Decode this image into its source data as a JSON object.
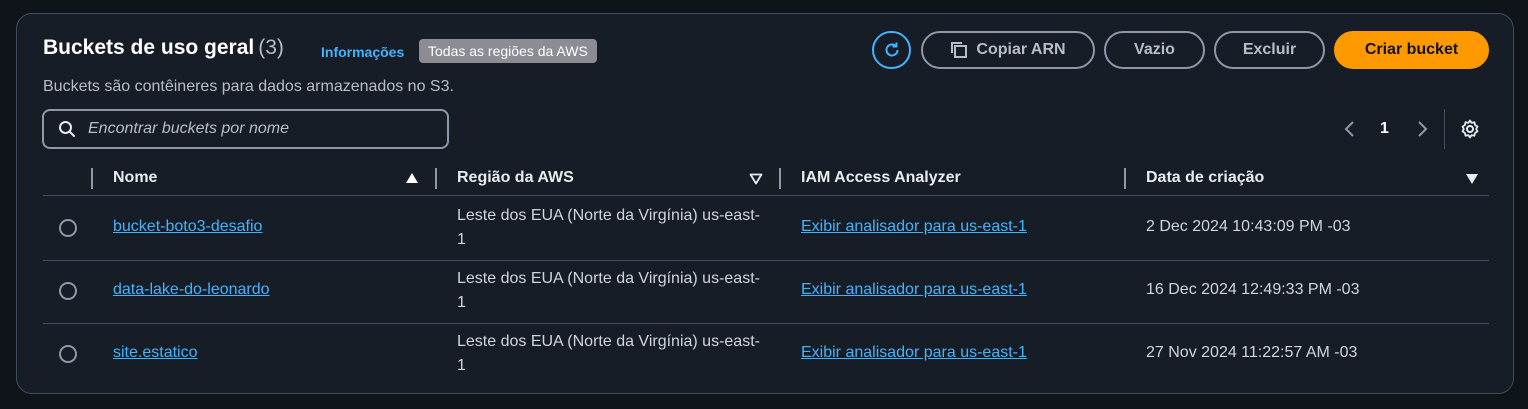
{
  "header": {
    "title": "Buckets de uso geral",
    "count": "(3)",
    "info_link": "Informações",
    "region_badge": "Todas as regiões da AWS",
    "subtitle": "Buckets são contêineres para dados armazenados no S3."
  },
  "toolbar": {
    "refresh_icon": "refresh-icon",
    "copy_arn_label": "Copiar ARN",
    "empty_label": "Vazio",
    "delete_label": "Excluir",
    "create_label": "Criar bucket"
  },
  "search": {
    "placeholder": "Encontrar buckets por nome",
    "value": ""
  },
  "pagination": {
    "current_page": "1"
  },
  "table": {
    "headers": [
      "Nome",
      "Região da AWS",
      "IAM Access Analyzer",
      "Data de criação"
    ],
    "rows": [
      {
        "name": "bucket-boto3-desafio",
        "region": "Leste dos EUA (Norte da Virgínia) us-east-1",
        "iam": "Exibir analisador para us-east-1",
        "created": "2 Dec 2024 10:43:09 PM -03"
      },
      {
        "name": "data-lake-do-leonardo",
        "region": "Leste dos EUA (Norte da Virgínia) us-east-1",
        "iam": "Exibir analisador para us-east-1",
        "created": "16 Dec 2024 12:49:33 PM -03"
      },
      {
        "name": "site.estatico",
        "region": "Leste dos EUA (Norte da Virgínia) us-east-1",
        "iam": "Exibir analisador para us-east-1",
        "created": "27 Nov 2024 11:22:57 AM -03"
      }
    ]
  },
  "colors": {
    "accent": "#ff9900",
    "link": "#42b4ff",
    "background": "#161d26"
  }
}
